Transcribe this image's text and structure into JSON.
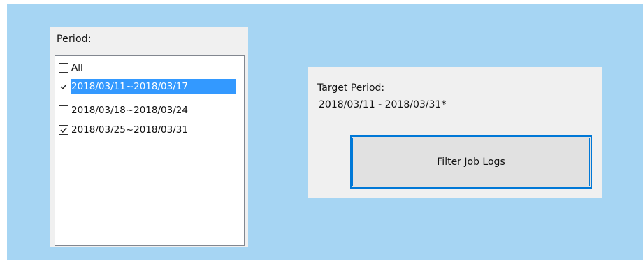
{
  "period": {
    "label_pre": "Perio",
    "label_mnemonic": "d",
    "label_post": ":",
    "items": [
      {
        "label": "All",
        "checked": false,
        "selected": false
      },
      {
        "label": "2018/03/11~2018/03/17",
        "checked": true,
        "selected": true
      },
      {
        "label": "2018/03/18~2018/03/24",
        "checked": false,
        "selected": false
      },
      {
        "label": "2018/03/25~2018/03/31",
        "checked": true,
        "selected": false
      }
    ]
  },
  "target": {
    "label": "Target Period:",
    "value": "2018/03/11 - 2018/03/31*"
  },
  "filter_button": {
    "label_pre": "Filter ",
    "label_mnemonic": "J",
    "label_post": "ob Logs"
  },
  "colors": {
    "background": "#a6d5f3",
    "panel": "#f0f0f0",
    "selection": "#3399ff",
    "focus_border": "#0078d7"
  }
}
